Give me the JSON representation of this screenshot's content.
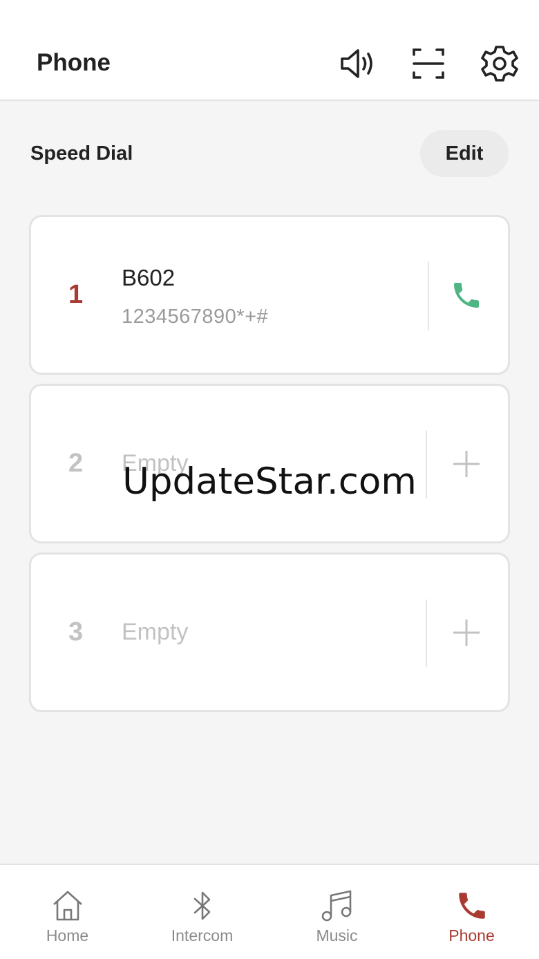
{
  "header": {
    "title": "Phone",
    "icons": [
      "speaker-icon",
      "scan-icon",
      "gear-icon"
    ]
  },
  "speed_dial": {
    "title": "Speed Dial",
    "edit_label": "Edit",
    "entries": [
      {
        "index": "1",
        "name": "B602",
        "number": "1234567890*+#",
        "action_icon": "phone-icon"
      },
      {
        "index": "2",
        "empty_label": "Empty",
        "action_icon": "plus-icon"
      },
      {
        "index": "3",
        "empty_label": "Empty",
        "action_icon": "plus-icon"
      }
    ]
  },
  "watermark": "UpdateStar.com",
  "nav": {
    "items": [
      {
        "label": "Home",
        "icon": "home-icon"
      },
      {
        "label": "Intercom",
        "icon": "bluetooth-icon"
      },
      {
        "label": "Music",
        "icon": "music-note-icon"
      },
      {
        "label": "Phone",
        "icon": "phone-icon",
        "active": true
      }
    ]
  },
  "colors": {
    "accent": "#a93a32",
    "call_green": "#4fb585",
    "muted_text": "#c2c2c2"
  }
}
